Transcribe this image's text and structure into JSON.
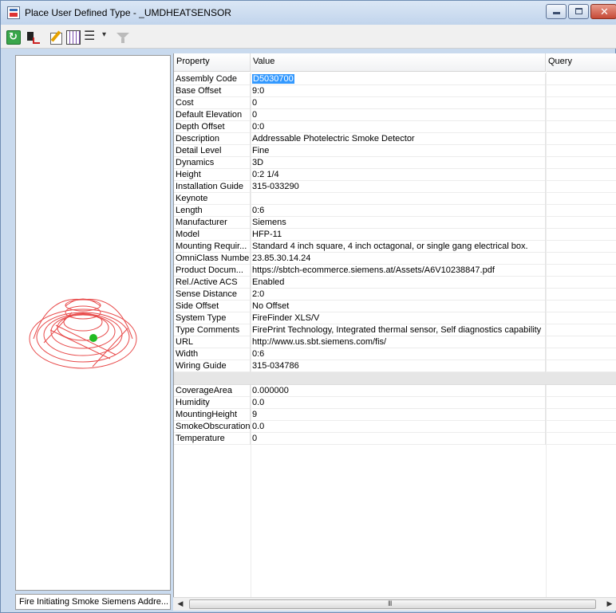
{
  "window": {
    "title": "Place User Defined Type - _UMDHEATSENSOR"
  },
  "toolbar": {
    "buttons": [
      "refresh-icon",
      "place-icon",
      "edit-icon",
      "grid-icon",
      "list-icon",
      "dropdown-icon",
      "filter-icon"
    ]
  },
  "grid": {
    "headers": {
      "property": "Property",
      "value": "Value",
      "query": "Query"
    },
    "rows": [
      {
        "property": "Assembly Code",
        "value": "D5030700"
      },
      {
        "property": "Base Offset",
        "value": "9:0"
      },
      {
        "property": "Cost",
        "value": "0"
      },
      {
        "property": "Default Elevation",
        "value": "0"
      },
      {
        "property": "Depth Offset",
        "value": "0:0"
      },
      {
        "property": "Description",
        "value": "Addressable Photelectric Smoke Detector"
      },
      {
        "property": "Detail Level",
        "value": "Fine"
      },
      {
        "property": "Dynamics",
        "value": "3D"
      },
      {
        "property": "Height",
        "value": "0:2 1/4"
      },
      {
        "property": "Installation Guide",
        "value": "315-033290"
      },
      {
        "property": "Keynote",
        "value": ""
      },
      {
        "property": "Length",
        "value": "0:6"
      },
      {
        "property": "Manufacturer",
        "value": "Siemens"
      },
      {
        "property": "Model",
        "value": "HFP-11"
      },
      {
        "property": "Mounting Requir...",
        "value": "Standard 4 inch square, 4 inch octagonal, or single gang electrical box."
      },
      {
        "property": "OmniClass Number",
        "value": "23.85.30.14.24"
      },
      {
        "property": "Product Docum...",
        "value": "https://sbtch-ecommerce.siemens.at/Assets/A6V10238847.pdf"
      },
      {
        "property": "Rel./Active ACS",
        "value": "Enabled"
      },
      {
        "property": "Sense Distance",
        "value": "2:0"
      },
      {
        "property": "Side Offset",
        "value": "No Offset"
      },
      {
        "property": "System Type",
        "value": "FireFinder XLS/V"
      },
      {
        "property": "Type Comments",
        "value": "FirePrint Technology, Integrated thermal sensor, Self diagnostics capability"
      },
      {
        "property": "URL",
        "value": "http://www.us.sbt.siemens.com/fis/"
      },
      {
        "property": "Width",
        "value": "0:6"
      },
      {
        "property": "Wiring Guide",
        "value": "315-034786"
      }
    ],
    "rows2": [
      {
        "property": "CoverageArea",
        "value": "0.000000"
      },
      {
        "property": "Humidity",
        "value": "0.0"
      },
      {
        "property": "MountingHeight",
        "value": "9"
      },
      {
        "property": "SmokeObscuration",
        "value": "0.0"
      },
      {
        "property": "Temperature",
        "value": "0"
      }
    ]
  },
  "status": {
    "text": "Fire Initiating Smoke Siemens Addre..."
  },
  "scrollbar": {
    "grip": "III"
  },
  "colors": {
    "selection": "#3399ff",
    "preview_lines": "#e84a4a",
    "preview_dot": "#22bb22"
  }
}
